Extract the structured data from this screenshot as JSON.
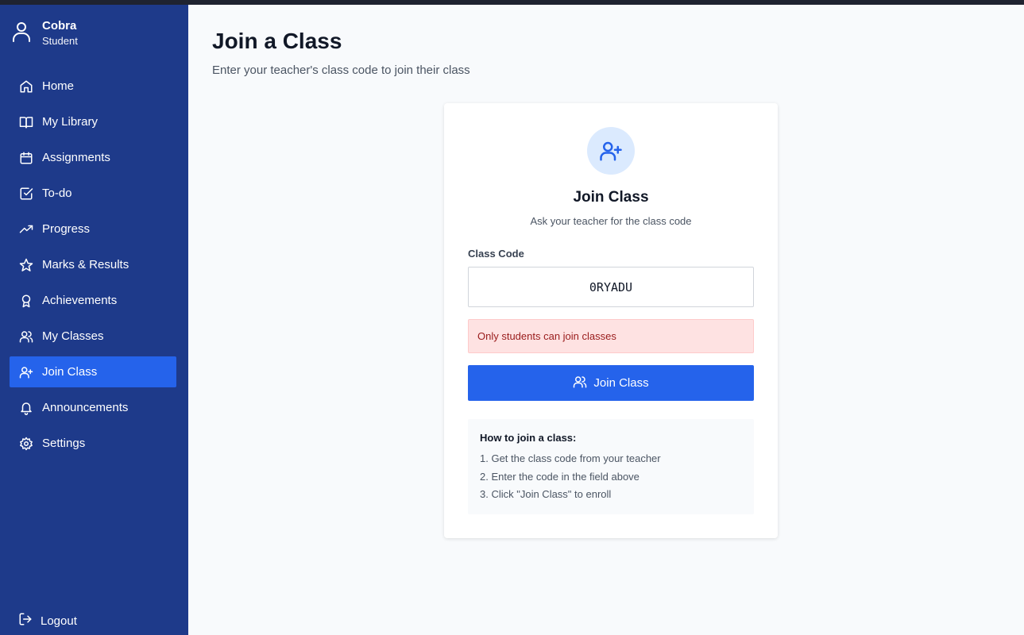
{
  "user": {
    "name": "Cobra",
    "role": "Student"
  },
  "nav": [
    {
      "label": "Home",
      "icon": "home-icon"
    },
    {
      "label": "My Library",
      "icon": "book-open-icon"
    },
    {
      "label": "Assignments",
      "icon": "calendar-icon"
    },
    {
      "label": "To-do",
      "icon": "check-square-icon"
    },
    {
      "label": "Progress",
      "icon": "trending-up-icon"
    },
    {
      "label": "Marks & Results",
      "icon": "star-icon"
    },
    {
      "label": "Achievements",
      "icon": "award-icon"
    },
    {
      "label": "My Classes",
      "icon": "users-icon"
    },
    {
      "label": "Join Class",
      "icon": "user-plus-icon",
      "active": true
    },
    {
      "label": "Announcements",
      "icon": "bell-icon"
    },
    {
      "label": "Settings",
      "icon": "gear-icon"
    }
  ],
  "logout": {
    "label": "Logout",
    "icon": "log-out-icon"
  },
  "page": {
    "title": "Join a Class",
    "subtitle": "Enter your teacher's class code to join their class"
  },
  "card": {
    "icon": "user-plus-icon",
    "title": "Join Class",
    "subtitle": "Ask your teacher for the class code",
    "field_label": "Class Code",
    "code_value": "0RYADU",
    "error": "Only students can join classes",
    "button_label": "Join Class",
    "button_icon": "users-icon",
    "howto_title": "How to join a class:",
    "howto_steps": [
      "1. Get the class code from your teacher",
      "2. Enter the code in the field above",
      "3. Click \"Join Class\" to enroll"
    ]
  },
  "colors": {
    "sidebar": "#1e3a8a",
    "active": "#2563eb",
    "error_bg": "#fee2e2",
    "error_text": "#991b1b"
  }
}
